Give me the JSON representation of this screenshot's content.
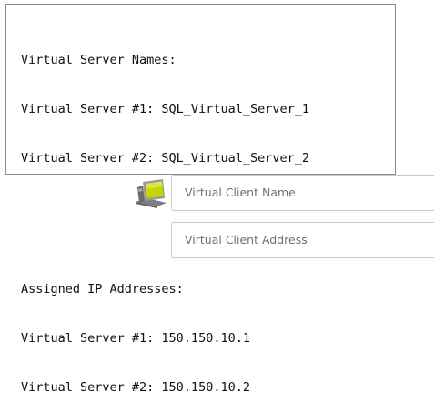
{
  "console": {
    "lines_a": [
      "Virtual Server Names:",
      "Virtual Server #1: SQL_Virtual_Server_1",
      "Virtual Server #2: SQL_Virtual_Server_2"
    ],
    "lines_b": [
      "Assigned IP Addresses:",
      "Virtual Server #1: 150.150.10.1",
      "Virtual Server #2: 150.150.10.2"
    ]
  },
  "client": {
    "icon": "computer-monitor-icon",
    "name_placeholder": "Virtual Client Name",
    "address_placeholder": "Virtual Client Address"
  },
  "colors": {
    "icon_screen": "#c8d400",
    "icon_body": "#8e8e8e",
    "border": "#8a8a8a"
  }
}
